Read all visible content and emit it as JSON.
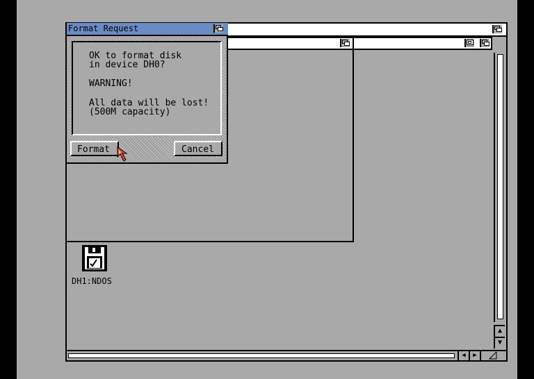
{
  "screen_bg": "#a9a9a9",
  "title_active": "#6a8cc4",
  "requester": {
    "title": "Format Request",
    "lines": [
      "OK to format disk",
      "in device DH0?",
      "WARNING!",
      "All data will be lost!",
      "(500M capacity)"
    ],
    "format_label": "Format",
    "cancel_label": "Cancel"
  },
  "desktop": {
    "icon_label": "DH1:NDOS",
    "icon_name": "disk-icon"
  },
  "scroll": {
    "up_arrow": "▲",
    "down_arrow": "▼",
    "left_arrow": "◀",
    "right_arrow": "▶"
  }
}
